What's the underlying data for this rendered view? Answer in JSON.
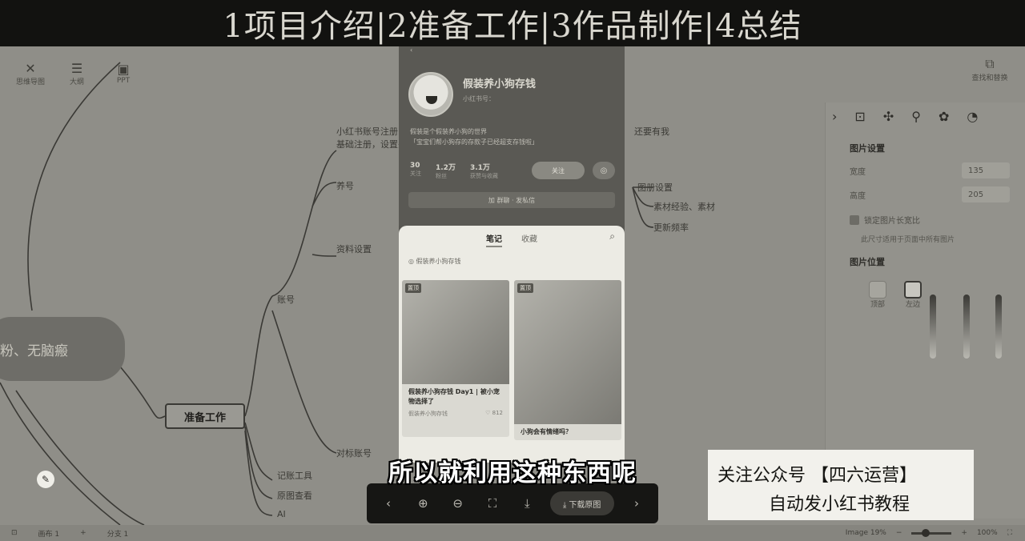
{
  "banner": {
    "text": "1项目介绍|2准备工作|3作品制作|4总结"
  },
  "toolbar_left": [
    {
      "label": "思维导图",
      "icon": "mindmap-icon",
      "glyph": "✕"
    },
    {
      "label": "大纲",
      "icon": "outline-icon",
      "glyph": "☰"
    },
    {
      "label": "PPT",
      "icon": "ppt-icon",
      "glyph": "▣"
    }
  ],
  "toolbar_right": {
    "label": "查找和替换",
    "icon": "find-replace-icon",
    "glyph": "⧉"
  },
  "mindmap": {
    "center_node": "粉、无脑瘢",
    "prep_node": "准备工作",
    "nodes": [
      {
        "text": "小红书账号注册"
      },
      {
        "text": "基础注册，设置头像、昵称等"
      },
      {
        "text": "养号"
      },
      {
        "text": "资料设置"
      },
      {
        "text": "账号"
      },
      {
        "text": "对标账号"
      },
      {
        "text": "记账工具"
      },
      {
        "text": "原图查看"
      },
      {
        "text": "AI"
      },
      {
        "text": "还要有我"
      },
      {
        "text": "图册设置"
      },
      {
        "text": "素材经验、素材"
      },
      {
        "text": "更新频率"
      }
    ]
  },
  "phone": {
    "topbar": "‹",
    "profile_name": "假装养小狗存钱",
    "profile_sub": "小红书号：",
    "bio_line1": "假装是个假装养小狗的世界",
    "bio_line2": "「宝宝们帮小狗存的存款子已经超支存钱啦」",
    "stats": [
      {
        "value": "30",
        "label": "关注"
      },
      {
        "value": "1.2万",
        "label": "粉丝"
      },
      {
        "value": "3.1万",
        "label": "获赞与收藏"
      }
    ],
    "follow_label": "关注",
    "more_label": "◎",
    "sub_bar": "加 群聊 · 发私信",
    "tabs": [
      "笔记",
      "收藏"
    ],
    "active_tab": "笔记",
    "pin_line": "◎ 假装养小狗存钱",
    "cards": [
      {
        "tag": "置顶",
        "title": "假装养小狗存钱 Day1 | 被小宠物选择了",
        "author": "假装养小狗存钱",
        "likes": "♡ 812"
      },
      {
        "tag": "置顶",
        "title": "小狗会有情绪吗？",
        "author": "",
        "likes": ""
      }
    ]
  },
  "controls": [
    {
      "name": "prev-button",
      "glyph": "‹"
    },
    {
      "name": "zoom-in-button",
      "glyph": "⊕"
    },
    {
      "name": "zoom-out-button",
      "glyph": "⊖"
    },
    {
      "name": "fullscreen-button",
      "glyph": "⛶"
    },
    {
      "name": "download-icon-button",
      "glyph": "⤓"
    }
  ],
  "download_label": "⤓ 下载原图",
  "next_glyph": "›",
  "subtitle": "所以就利用这种东西呢",
  "promo": {
    "line1": "关注公众号 【四六运营】",
    "line2": "自动发小红书教程"
  },
  "right_panel": {
    "tabs": [
      "›",
      "⊡",
      "✣",
      "⚲",
      "✿",
      "◔"
    ],
    "section_title": "图片设置",
    "width_label": "宽度",
    "width_value": "135",
    "height_label": "高度",
    "height_value": "205",
    "lock_label": "锁定图片长宽比",
    "hint": "此尺寸适用于页面中所有图片",
    "position_title": "图片位置",
    "positions": [
      {
        "label": "顶部"
      },
      {
        "label": "左边"
      }
    ]
  },
  "status_bar": {
    "left": [
      "⊡",
      "画布 1",
      "+",
      "分支 1"
    ],
    "image_zoom": "Image 19%",
    "zoom_percent": "100%",
    "zoom_level": 0.36
  },
  "colors": {
    "banner_bg": "#121210",
    "editor_bg": "#8f8e88",
    "promo_bg": "#f2f1ec"
  }
}
